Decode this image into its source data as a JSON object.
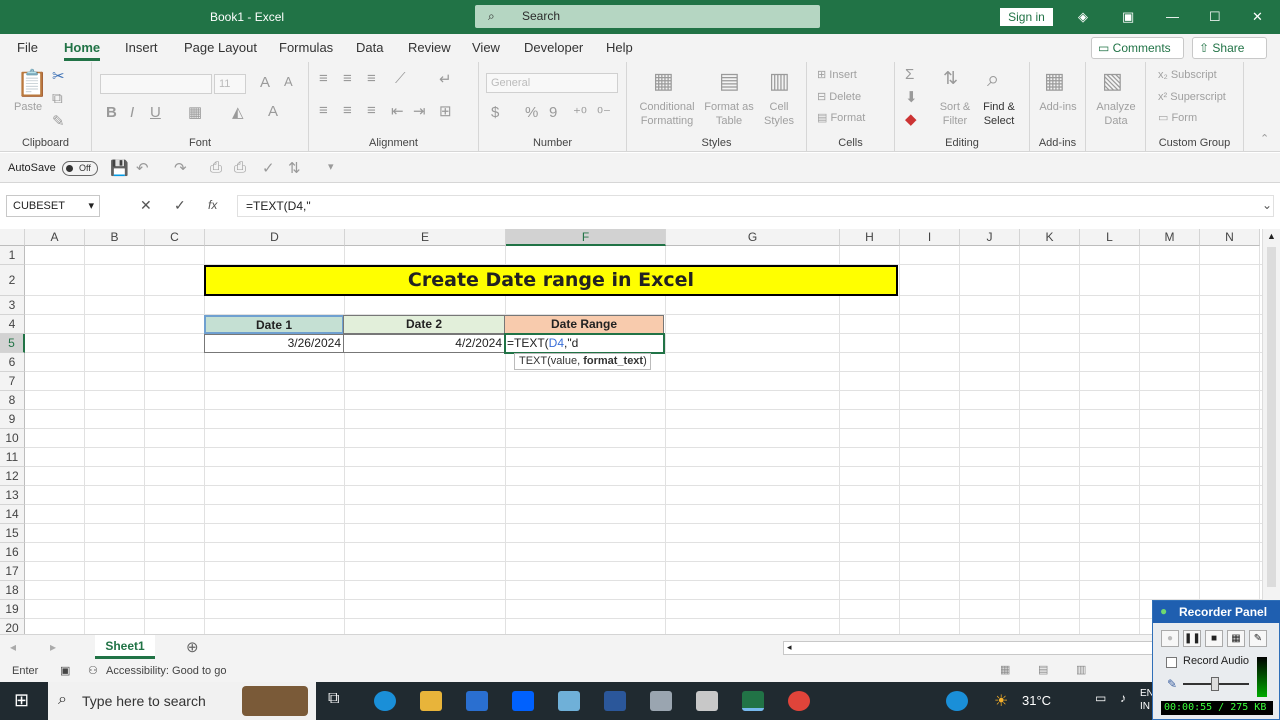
{
  "window": {
    "title": "Book1  -  Excel",
    "search_placeholder": "Search",
    "signin": "Sign in"
  },
  "menu": {
    "tabs": [
      "File",
      "Home",
      "Insert",
      "Page Layout",
      "Formulas",
      "Data",
      "Review",
      "View",
      "Developer",
      "Help"
    ],
    "comments": "Comments",
    "share": "Share"
  },
  "ribbon": {
    "clipboard": {
      "paste": "Paste",
      "label": "Clipboard"
    },
    "font": {
      "label": "Font",
      "font_size": "11",
      "bold": "B",
      "italic": "I",
      "underline": "U"
    },
    "alignment": {
      "label": "Alignment"
    },
    "number": {
      "label": "Number",
      "format": "General",
      "currency": "$",
      "percent": "%",
      "comma": "9"
    },
    "styles": {
      "label": "Styles",
      "conditional": "Conditional Formatting",
      "format_as_table": "Format as Table",
      "cell_styles": "Cell Styles"
    },
    "cells": {
      "label": "Cells",
      "insert": "Insert",
      "delete": "Delete",
      "format": "Format"
    },
    "editing": {
      "label": "Editing",
      "sort_filter": "Sort & Filter",
      "find_select": "Find & Select"
    },
    "addins": {
      "label": "Add-ins",
      "addins": "Add-ins"
    },
    "analyze": {
      "analyze": "Analyze Data"
    },
    "custom": {
      "label": "Custom Group",
      "subscript": "Subscript",
      "superscript": "Superscript",
      "form": "Form"
    }
  },
  "qat": {
    "autosave": "AutoSave",
    "toggle": "Off"
  },
  "formula_bar": {
    "name_box": "CUBESET",
    "formula": "=TEXT(D4,\"",
    "fx": "fx"
  },
  "grid": {
    "columns": [
      "A",
      "B",
      "C",
      "D",
      "E",
      "F",
      "G",
      "H",
      "I",
      "J",
      "K",
      "L",
      "M",
      "N"
    ],
    "rows": [
      "1",
      "2",
      "3",
      "4",
      "5",
      "6",
      "7",
      "8",
      "9",
      "10",
      "11",
      "12",
      "13",
      "14",
      "15",
      "16",
      "17",
      "18",
      "19",
      "20"
    ],
    "title": "Create Date range in Excel",
    "headers": {
      "date1": "Date 1",
      "date2": "Date 2",
      "range": "Date Range"
    },
    "values": {
      "date1": "3/26/2024",
      "date2": "4/2/2024"
    },
    "active_prefix": "=TEXT(",
    "active_ref": "D4",
    "active_suffix": ",\"d",
    "tooltip_a": "TEXT(value, ",
    "tooltip_b": "format_text",
    "tooltip_c": ")",
    "colors": {
      "date1_header": "#c5e0d3",
      "date2_header": "#e2efda",
      "range_header": "#f8cbad",
      "title_bg": "#ffff00",
      "accent": "#217346"
    }
  },
  "sheets": {
    "active": "Sheet1"
  },
  "status": {
    "mode": "Enter",
    "accessibility": "Accessibility: Good to go"
  },
  "taskbar": {
    "search": "Type here to search",
    "temp": "31°C",
    "lang": "EN IN"
  },
  "recorder": {
    "title": "Recorder Panel",
    "record_audio": "Record Audio",
    "clock": "00:00:55 / 275 KB"
  }
}
